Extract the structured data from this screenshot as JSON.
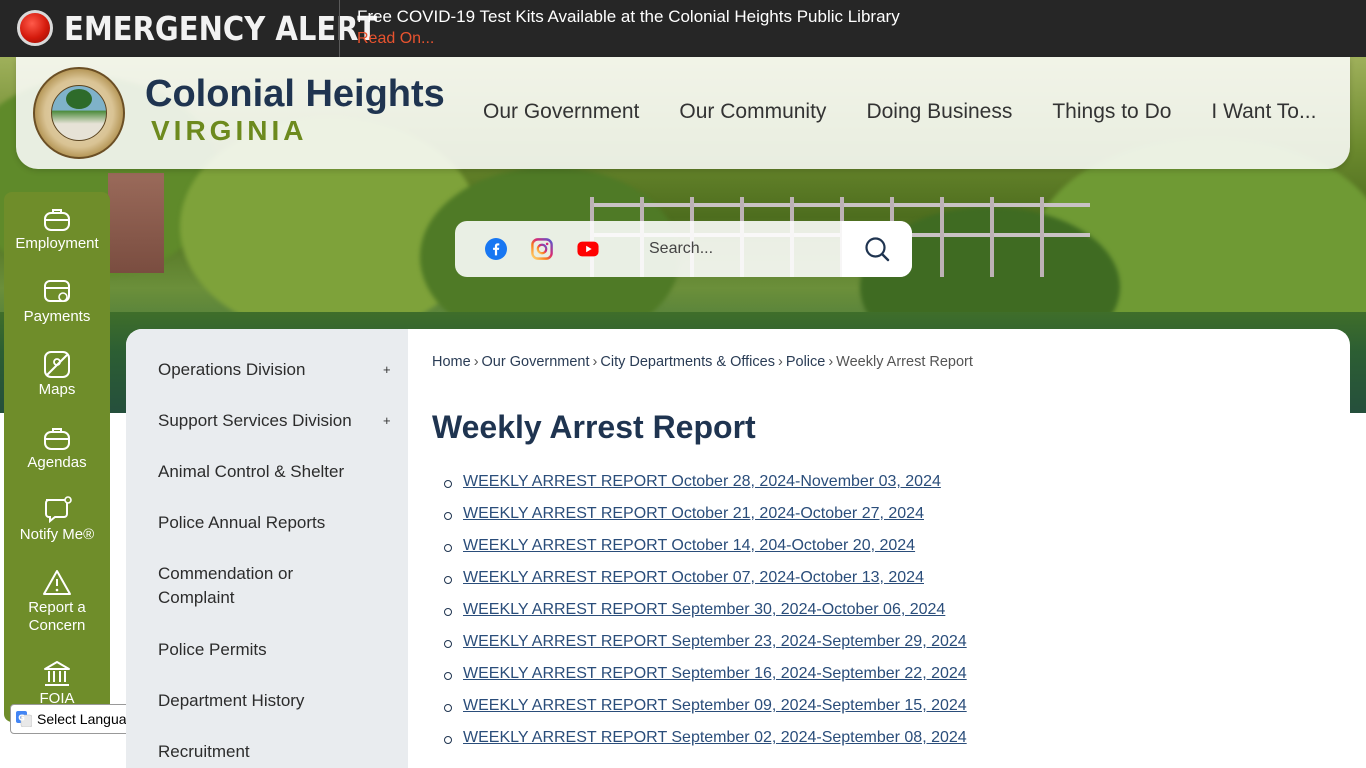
{
  "alert": {
    "title": "EMERGENCY ALERT",
    "message": "Free COVID-19 Test Kits Available at the Colonial Heights Public Library",
    "read_on": "Read On..."
  },
  "header": {
    "city_name": "Colonial Heights",
    "state": "VIRGINIA",
    "nav": [
      "Our Government",
      "Our Community",
      "Doing Business",
      "Things to Do",
      "I Want To..."
    ]
  },
  "search": {
    "placeholder": "Search..."
  },
  "social": [
    "facebook-icon",
    "instagram-icon",
    "youtube-icon"
  ],
  "quicklinks": [
    {
      "label": "Employment",
      "icon": "briefcase-icon"
    },
    {
      "label": "Payments",
      "icon": "payment-card-icon"
    },
    {
      "label": "Maps",
      "icon": "map-icon"
    },
    {
      "label": "Agendas",
      "icon": "agenda-icon"
    },
    {
      "label": "Notify Me®",
      "icon": "notify-chat-icon"
    },
    {
      "label": "Report a Concern",
      "icon": "warning-icon"
    },
    {
      "label": "FOIA",
      "icon": "building-icon"
    }
  ],
  "language": {
    "selected": "Select Language"
  },
  "subnav": [
    {
      "label": "Operations Division",
      "expandable": true
    },
    {
      "label": "Support Services Division",
      "expandable": true
    },
    {
      "label": "Animal Control & Shelter",
      "expandable": false
    },
    {
      "label": "Police Annual Reports",
      "expandable": false
    },
    {
      "label": "Commendation or Complaint",
      "expandable": false
    },
    {
      "label": "Police Permits",
      "expandable": false
    },
    {
      "label": "Department History",
      "expandable": false
    },
    {
      "label": "Recruitment",
      "expandable": false
    }
  ],
  "subnav_expand_symbol": "+",
  "breadcrumb": [
    "Home",
    "Our Government",
    "City Departments & Offices",
    "Police",
    "Weekly Arrest Report"
  ],
  "breadcrumb_separator": "›",
  "page": {
    "title": "Weekly Arrest Report",
    "reports": [
      "WEEKLY ARREST REPORT October 28, 2024-November 03, 2024",
      "WEEKLY ARREST REPORT October 21, 2024-October 27, 2024",
      "WEEKLY ARREST REPORT October 14, 204-October 20, 2024",
      "WEEKLY ARREST REPORT October 07, 2024-October 13, 2024",
      "WEEKLY ARREST REPORT September 30, 2024-October 06, 2024",
      "WEEKLY ARREST REPORT September 23, 2024-September 29, 2024",
      "WEEKLY ARREST REPORT September 16, 2024-September 22, 2024",
      "WEEKLY ARREST REPORT September 09, 2024-September 15, 2024",
      "WEEKLY ARREST REPORT September 02, 2024-September 08, 2024"
    ]
  },
  "colors": {
    "alert_bg": "#262626",
    "alert_link": "#e8532f",
    "brand_navy": "#1f3450",
    "brand_green": "#6f8d2a",
    "link": "#2a4d7a",
    "subnav_bg": "#e9ecef"
  }
}
